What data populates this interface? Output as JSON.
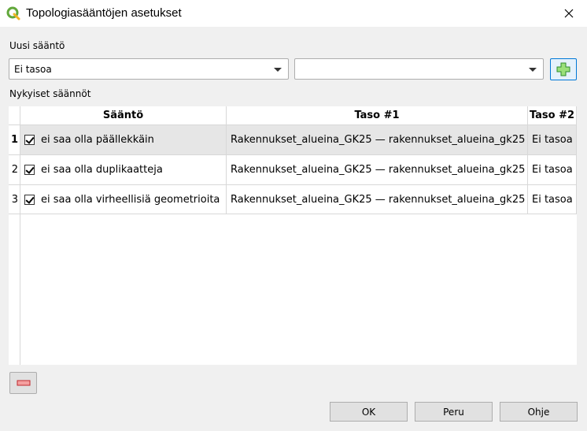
{
  "window": {
    "title": "Topologiasääntöjen asetukset"
  },
  "new_rule": {
    "label": "Uusi sääntö",
    "layer1_value": "Ei tasoa",
    "layer2_value": ""
  },
  "current_rules": {
    "label": "Nykyiset säännöt",
    "columns": [
      "Sääntö",
      "Taso #1",
      "Taso #2"
    ],
    "rows": [
      {
        "num": "1",
        "rule": "ei saa olla päällekkäin",
        "layer1": "Rakennukset_alueina_GK25 — rakennukset_alueina_gk25",
        "layer2": "Ei tasoa",
        "checked": true
      },
      {
        "num": "2",
        "rule": "ei saa olla duplikaatteja",
        "layer1": "Rakennukset_alueina_GK25 — rakennukset_alueina_gk25",
        "layer2": "Ei tasoa",
        "checked": true
      },
      {
        "num": "3",
        "rule": "ei saa olla virheellisiä geometrioita",
        "layer1": "Rakennukset_alueina_GK25 — rakennukset_alueina_gk25",
        "layer2": "Ei tasoa",
        "checked": true
      }
    ]
  },
  "buttons": {
    "ok": "OK",
    "cancel": "Peru",
    "help": "Ohje"
  },
  "icons": {
    "app": "qgis-icon",
    "add": "green-plus-icon",
    "remove": "red-minus-icon",
    "close": "close-icon"
  },
  "colors": {
    "add_plus": "#3cb043",
    "remove_minus": "#e04848",
    "selected_row": "#e6e6e6"
  }
}
